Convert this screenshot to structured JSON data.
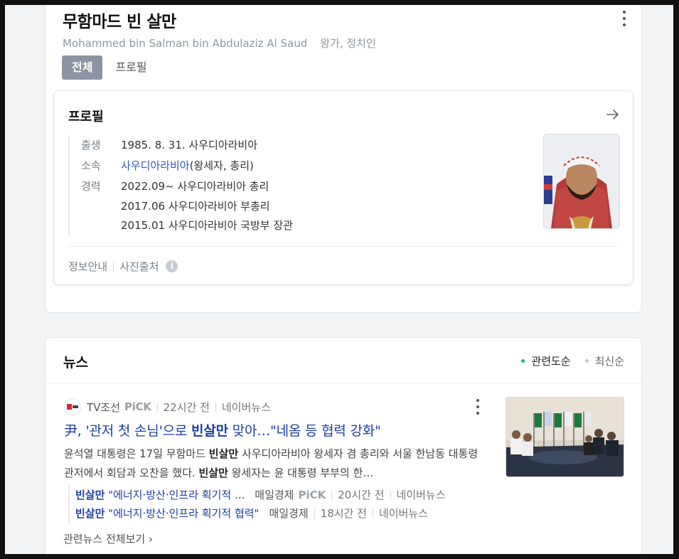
{
  "person": {
    "name_ko": "무함마드 빈 살만",
    "name_en": "Mohammed bin Salman bin Abdulaziz Al Saud",
    "occupation": "왕가, 정치인"
  },
  "tabs": [
    {
      "label": "전체",
      "active": true
    },
    {
      "label": "프로필",
      "active": false
    }
  ],
  "profile": {
    "title": "프로필",
    "birth_label": "출생",
    "birth_value": "1985. 8. 31. 사우디아라비아",
    "affiliation_label": "소속",
    "affiliation_link": "사우디아라비아",
    "affiliation_rest": "(왕세자, 총리)",
    "career_label": "경력",
    "career": [
      "2022.09~ 사우디아라비아 총리",
      "2017.06 사우디아라비아 부총리",
      "2015.01 사우디아라비아 국방부 장관"
    ],
    "footer_info": "정보안내",
    "footer_photo": "사진출처"
  },
  "news": {
    "title": "뉴스",
    "sort_related": "관련도순",
    "sort_latest": "최신순",
    "accent_color": "#03c75a",
    "item": {
      "press": "TV조선",
      "pick": "PiCK",
      "time": "22시간 전",
      "source": "네이버뉴스",
      "headline_pre": "尹, '관저 첫 손님'으로 ",
      "headline_bold": "빈살만",
      "headline_post": " 맞아…\"네옴 등 협력 강화\"",
      "snippet_1": "윤석열 대통령은 17일 무함마드 ",
      "snippet_b1": "빈살만",
      "snippet_2": " 사우디아라비아 왕세자 겸 총리와 서울 한남동 대통령 관저에서 회담과 오찬을 했다. ",
      "snippet_b2": "빈살만",
      "snippet_3": " 왕세자는 윤 대통령 부부의 한…"
    },
    "related": [
      {
        "bold": "빈살만",
        "rest": " \"에너지·방산·인프라 획기적 ...",
        "press": "매일경제",
        "pick": "PiCK",
        "time": "20시간 전",
        "source": "네이버뉴스"
      },
      {
        "bold": "빈살만",
        "rest": " \"에너지·방산·인프라 획기적 협력\"",
        "press": "매일경제",
        "pick": "",
        "time": "18시간 전",
        "source": "네이버뉴스"
      }
    ],
    "all_news": "관련뉴스 전체보기"
  }
}
